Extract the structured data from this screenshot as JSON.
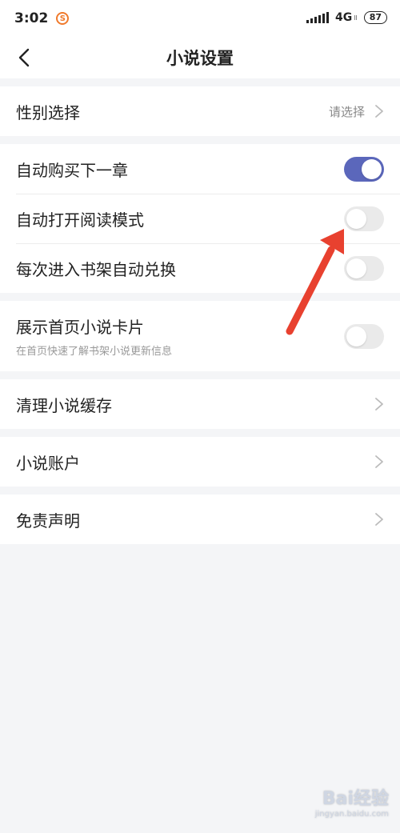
{
  "status_bar": {
    "time": "3:02",
    "app_icon_glyph": "S",
    "network": "4G",
    "network_sub": "ll",
    "battery": "87"
  },
  "nav": {
    "title": "小说设置",
    "back_icon": "chevron-left-icon"
  },
  "groups": {
    "gender": {
      "label": "性别选择",
      "value": "请选择"
    },
    "auto": {
      "buy_next": {
        "label": "自动购买下一章",
        "toggle": "on"
      },
      "reading_mode": {
        "label": "自动打开阅读模式",
        "toggle": "off"
      },
      "shelf_redeem": {
        "label": "每次进入书架自动兑换",
        "toggle": "off"
      }
    },
    "card": {
      "label": "展示首页小说卡片",
      "sub": "在首页快速了解书架小说更新信息",
      "toggle": "off"
    },
    "cache": {
      "label": "清理小说缓存"
    },
    "account": {
      "label": "小说账户"
    },
    "disclaimer": {
      "label": "免责声明"
    }
  },
  "watermark": {
    "main": "Bai经验",
    "sub": "jingyan.baidu.com"
  },
  "colors": {
    "toggle_on": "#5b67bb",
    "toggle_off": "#eaeaea",
    "annotation_arrow": "#e8412f",
    "app_icon": "#f07a2c",
    "background": "#f4f5f7"
  }
}
